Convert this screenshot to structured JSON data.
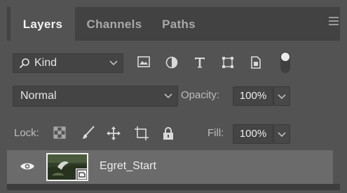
{
  "tabs": [
    {
      "label": "Layers",
      "active": true
    },
    {
      "label": "Channels",
      "active": false
    },
    {
      "label": "Paths",
      "active": false
    }
  ],
  "filter": {
    "kind_label": "Kind",
    "icons": [
      "pixel-layer-filter-icon",
      "adjustment-layer-filter-icon",
      "type-layer-filter-icon",
      "shape-layer-filter-icon",
      "smart-object-filter-icon"
    ],
    "toggle_on": true
  },
  "blend": {
    "mode": "Normal",
    "opacity_label": "Opacity:",
    "opacity_value": "100%"
  },
  "lock": {
    "label": "Lock:",
    "icons": [
      "lock-transparent-pixels-icon",
      "lock-image-pixels-icon",
      "lock-position-icon",
      "lock-artboard-icon",
      "lock-all-icon"
    ],
    "fill_label": "Fill:",
    "fill_value": "100%"
  },
  "layers": [
    {
      "name": "Egret_Start",
      "visible": true,
      "type": "smart-object"
    }
  ],
  "colors": {
    "panel_bg": "#535353",
    "tabbar_bg": "#424242",
    "selected_layer_bg": "#6b6b6b"
  }
}
